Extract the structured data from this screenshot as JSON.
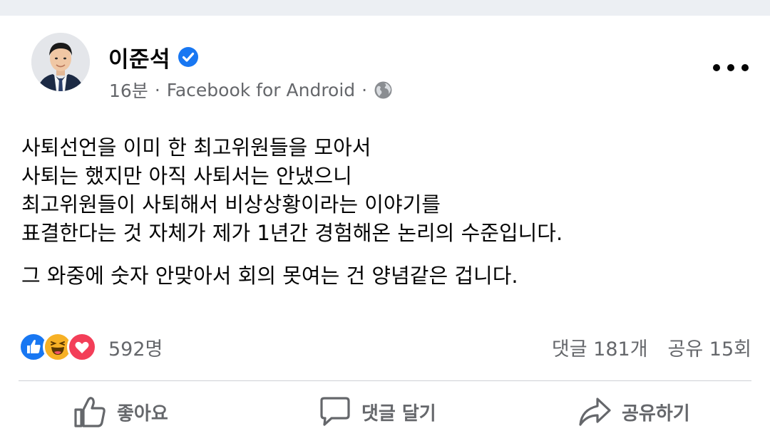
{
  "post": {
    "author_name": "이준석",
    "time": "16분",
    "separator": "·",
    "source": "Facebook for Android",
    "separator2": "·",
    "body_lines": [
      "사퇴선언을 이미 한 최고위원들을 모아서",
      "사퇴는 했지만 아직 사퇴서는 안냈으니",
      "최고위원들이 사퇴해서 비상상황이라는 이야기를",
      "표결한다는 것 자체가 제가 1년간 경험해온 논리의 수준입니다."
    ],
    "body_para2": "그 와중에 숫자 안맞아서 회의 못여는 건 양념같은 겁니다."
  },
  "reactions": {
    "count": "592명",
    "types": [
      "like-icon",
      "haha-icon",
      "love-icon"
    ]
  },
  "stats": {
    "comments": "댓글 181개",
    "shares": "공유 15회"
  },
  "actions": {
    "like": "좋아요",
    "comment": "댓글 달기",
    "share": "공유하기"
  },
  "icons": {
    "verified": "verified-badge-icon",
    "privacy": "globe-icon",
    "more": "more-options-icon"
  },
  "colors": {
    "fb_blue": "#1877f2",
    "secondary_text": "#65676b",
    "primary_text": "#050505",
    "haha_yellow": "#f7b125",
    "love_red": "#f33e58",
    "top_band": "#eceff3"
  }
}
